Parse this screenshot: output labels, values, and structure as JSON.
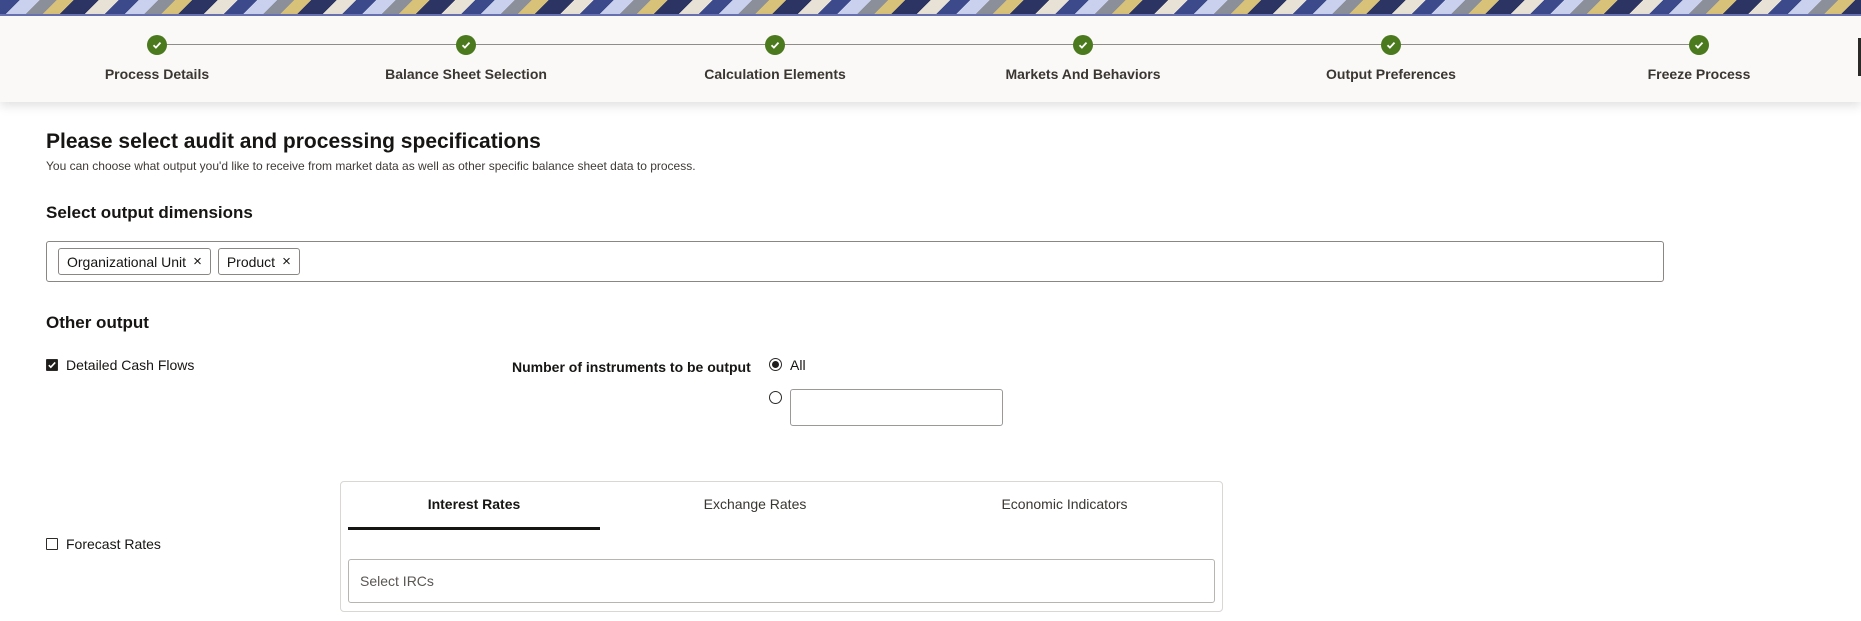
{
  "train": {
    "steps": [
      {
        "label": "Process Details",
        "status": "complete"
      },
      {
        "label": "Balance Sheet Selection",
        "status": "complete"
      },
      {
        "label": "Calculation Elements",
        "status": "complete"
      },
      {
        "label": "Markets And Behaviors",
        "status": "complete"
      },
      {
        "label": "Output Preferences",
        "status": "complete"
      },
      {
        "label": "Freeze Process",
        "status": "complete"
      }
    ],
    "complete_color": "#4b7a1e"
  },
  "page": {
    "title": "Please select audit and processing specifications",
    "subtitle": "You can choose what output you'd like to receive from market data as well as other specific balance sheet data to process."
  },
  "output_dimensions": {
    "heading": "Select output dimensions",
    "chips": [
      {
        "label": "Organizational Unit"
      },
      {
        "label": "Product"
      }
    ],
    "remove_icon": "×"
  },
  "other_output": {
    "heading": "Other output",
    "detailed_cash_flows": {
      "label": "Detailed Cash Flows",
      "checked": true
    },
    "instruments": {
      "label": "Number of instruments to be output",
      "options": [
        {
          "label": "All",
          "selected": true
        },
        {
          "label": "",
          "selected": false,
          "value": ""
        }
      ]
    },
    "forecast_rates": {
      "label": "Forecast Rates",
      "checked": false
    }
  },
  "rates_panel": {
    "tabs": [
      {
        "label": "Interest Rates",
        "active": true
      },
      {
        "label": "Exchange Rates",
        "active": false
      },
      {
        "label": "Economic Indicators",
        "active": false
      }
    ],
    "irc_placeholder": "Select IRCs"
  }
}
